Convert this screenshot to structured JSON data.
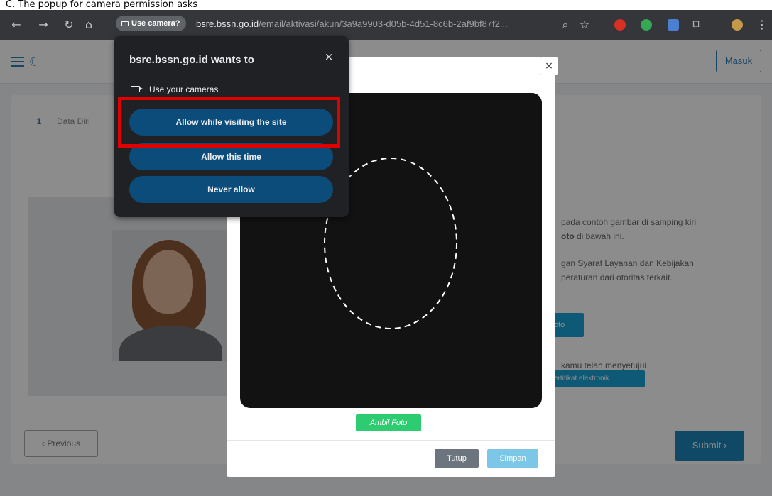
{
  "banner": {
    "text": "C. The popup for camera permission asks "
  },
  "browser": {
    "camera_chip": "Use camera?",
    "url_domain": "bsre.bssn.go.id",
    "url_path": "/email/aktivasi/akun/3a9a9903-d05b-4d51-8c6b-2af9bf87f2..."
  },
  "page": {
    "login_button": "Masuk",
    "step_number": "1",
    "step_label": "Data Diri",
    "instruction_line1": "pada contoh gambar di samping kiri",
    "instruction_line2_bold": "oto",
    "instruction_line2": " di bawah ini.",
    "terms_line1": "gan Syarat Layanan dan Kebijakan",
    "terms_line2": "peraturan dari otoritas terkait.",
    "photo_button": "oto",
    "agree_text": "kamu telah menyetujui",
    "cert_button": "ertifikat elektronik",
    "previous_button": "‹ Previous",
    "submit_button": "Submit ›"
  },
  "modal": {
    "close": "×",
    "capture_button": "Ambil Foto",
    "close_button": "Tutup",
    "save_button": "Simpan"
  },
  "popup": {
    "title": "bsre.bssn.go.id wants to",
    "close": "×",
    "permission": "Use your cameras",
    "allow_visiting": "Allow while visiting the site",
    "allow_once": "Allow this time",
    "never_allow": "Never allow"
  },
  "colors": {
    "popup_button": "#0b4c7a",
    "highlight": "#e00000",
    "primary": "#1e86b8",
    "capture": "#2ecc71"
  }
}
